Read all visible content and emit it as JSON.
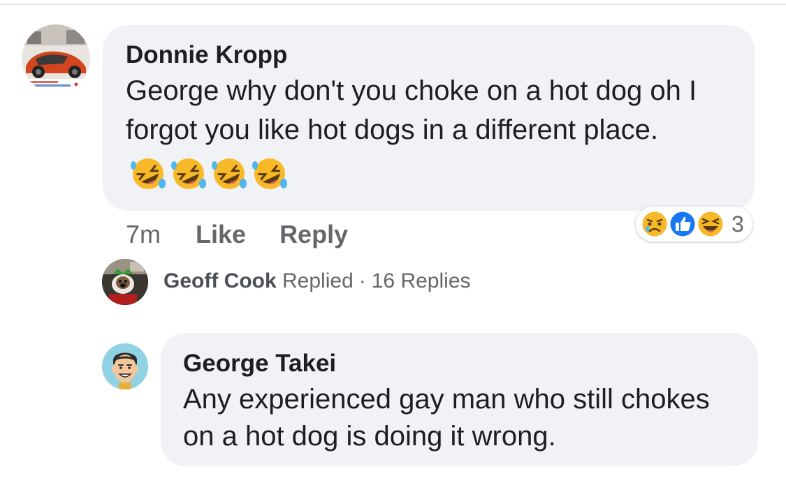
{
  "comment": {
    "author": "Donnie Kropp",
    "text": "George why don't you choke on a hot dog oh I forgot you like hot dogs  in a different place.",
    "emoji_count": 4,
    "emoji_name": "rolling-on-the-floor-laughing",
    "time": "7m",
    "like_label": "Like",
    "reply_label": "Reply",
    "reactions": {
      "types": [
        "sad",
        "like",
        "haha"
      ],
      "count": "3"
    }
  },
  "replied": {
    "name": "Geoff Cook",
    "verb": "Replied",
    "separator": "·",
    "replies_link": "16 Replies"
  },
  "reply": {
    "author": "George Takei",
    "text": "Any experienced gay man who still chokes on a hot dog is doing it wrong."
  },
  "colors": {
    "bubble": "#f0f2f5",
    "meta_text": "#65676b",
    "like_blue": "#1877f2",
    "reaction_yellow": "#f7b928"
  }
}
